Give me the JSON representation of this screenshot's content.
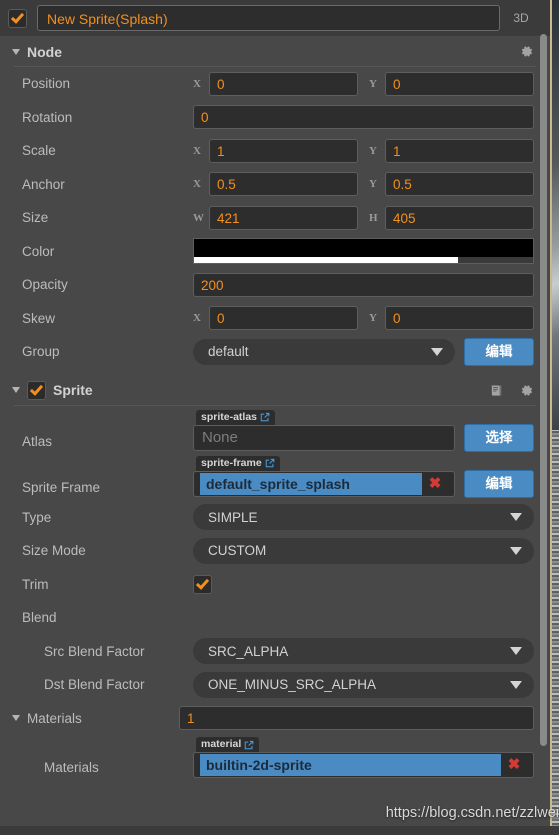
{
  "header": {
    "node_enabled": true,
    "node_name": "New Sprite(Splash)",
    "mode_label": "3D"
  },
  "node_section": {
    "title": "Node",
    "expanded": true,
    "gear_icon": "gear-icon",
    "rows": {
      "position": {
        "label": "Position",
        "x_axis": "X",
        "x": "0",
        "y_axis": "Y",
        "y": "0"
      },
      "rotation": {
        "label": "Rotation",
        "value": "0"
      },
      "scale": {
        "label": "Scale",
        "x_axis": "X",
        "x": "1",
        "y_axis": "Y",
        "y": "1"
      },
      "anchor": {
        "label": "Anchor",
        "x_axis": "X",
        "x": "0.5",
        "y_axis": "Y",
        "y": "0.5"
      },
      "size": {
        "label": "Size",
        "w_axis": "W",
        "w": "421",
        "h_axis": "H",
        "h": "405"
      },
      "color": {
        "label": "Color",
        "hex": "#000000",
        "alpha_percent": 78
      },
      "opacity": {
        "label": "Opacity",
        "value": "200"
      },
      "skew": {
        "label": "Skew",
        "x_axis": "X",
        "x": "0",
        "y_axis": "Y",
        "y": "0"
      },
      "group": {
        "label": "Group",
        "value": "default",
        "button": "编辑"
      }
    }
  },
  "sprite_section": {
    "title": "Sprite",
    "enabled": true,
    "expanded": true,
    "help_icon": "book-icon",
    "gear_icon": "gear-icon",
    "rows": {
      "atlas": {
        "label": "Atlas",
        "tag": "sprite-atlas",
        "tag_icon": "external-link-icon",
        "value": "None",
        "empty": true,
        "button": "选择"
      },
      "sprite_frame": {
        "label": "Sprite Frame",
        "tag": "sprite-frame",
        "tag_icon": "external-link-icon",
        "value": "default_sprite_splash",
        "clear_icon": "close-icon",
        "button": "编辑"
      },
      "type": {
        "label": "Type",
        "value": "SIMPLE"
      },
      "size_mode": {
        "label": "Size Mode",
        "value": "CUSTOM"
      },
      "trim": {
        "label": "Trim",
        "checked": true
      },
      "blend": {
        "label": "Blend"
      },
      "src_blend_factor": {
        "label": "Src Blend Factor",
        "value": "SRC_ALPHA"
      },
      "dst_blend_factor": {
        "label": "Dst Blend Factor",
        "value": "ONE_MINUS_SRC_ALPHA"
      },
      "materials_array": {
        "label": "Materials",
        "count": "1",
        "expanded": true
      },
      "materials_item": {
        "label": "Materials",
        "tag": "material",
        "tag_icon": "external-link-icon",
        "value": "builtin-2d-sprite",
        "clear_icon": "close-icon"
      }
    }
  },
  "watermark": {
    "text": "https://blog.csdn.net/zzlwei"
  },
  "colors": {
    "accent_orange": "#f3901d",
    "accent_blue": "#4a8bc4",
    "danger_red": "#d33b36",
    "panel_bg": "#484848"
  }
}
